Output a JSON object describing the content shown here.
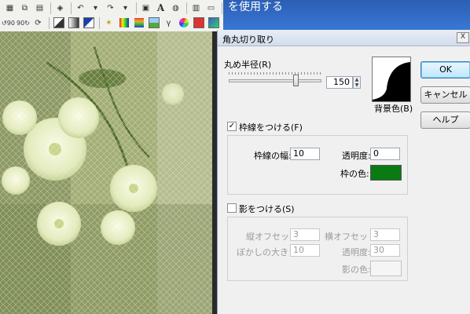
{
  "background_app": {
    "title_fragment": "を使用する",
    "toolbar_row1": [
      "undo-icon",
      "redo-icon",
      "grid-icon",
      "text-icon",
      "shape-icon",
      "layout-icon",
      "dropdown-icon"
    ],
    "toolbar_row2_labels": [
      "90",
      "90"
    ]
  },
  "dialog": {
    "title": "角丸切り取り",
    "close_label": "X",
    "radius": {
      "label": "丸め半径(R)",
      "value": "150",
      "slider_fraction": 0.72
    },
    "bg_color_label": "背景色(B)",
    "buttons": {
      "ok": "OK",
      "cancel": "キャンセル",
      "help": "ヘルプ"
    },
    "border": {
      "checkbox_label": "枠線をつける(F)",
      "checked": true,
      "width_label": "枠線の幅:",
      "width_value": "10",
      "opacity_label": "透明度:",
      "opacity_value": "0",
      "color_label": "枠の色:",
      "color": "#0a7a12"
    },
    "shadow": {
      "checkbox_label": "影をつける(S)",
      "checked": false,
      "v_offset_label": "縦オフセット:",
      "v_offset_value": "3",
      "h_offset_label": "横オフセット:",
      "h_offset_value": "3",
      "blur_label": "ぼかしの大きさ:",
      "blur_value": "10",
      "opacity_label": "透明度:",
      "opacity_value": "30",
      "color_label": "影の色:"
    }
  }
}
